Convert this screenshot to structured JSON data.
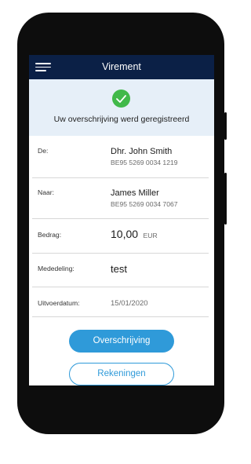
{
  "appbar": {
    "title": "Virement"
  },
  "banner": {
    "message": "Uw overschrijving werd geregistreerd"
  },
  "details": {
    "from": {
      "label": "De:",
      "name": "Dhr. John Smith",
      "iban": "BE95 5269 0034 1219"
    },
    "to": {
      "label": "Naar:",
      "name": "James Miller",
      "iban": "BE95 5269 0034 7067"
    },
    "amount": {
      "label": "Bedrag:",
      "value": "10,00",
      "currency": "EUR"
    },
    "message": {
      "label": "Mededeling:",
      "value": "test"
    },
    "execution_date": {
      "label": "Uitvoerdatum:",
      "value": "15/01/2020"
    }
  },
  "actions": {
    "primary_label": "Overschrijving",
    "secondary_label": "Rekeningen"
  },
  "colors": {
    "appbar": "#0b2046",
    "banner": "#e6eff8",
    "success": "#41b94a",
    "accent": "#2f9ad9"
  },
  "icons": {
    "menu": "hamburger-menu-icon",
    "success": "check-circle-icon"
  }
}
